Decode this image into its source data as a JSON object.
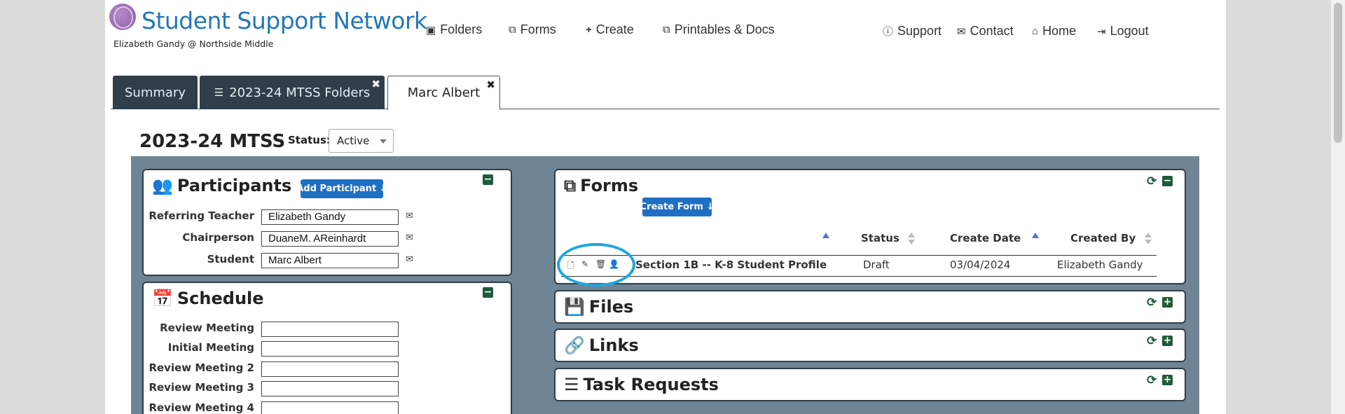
{
  "brand": {
    "title": "Student Support Network",
    "user": "Elizabeth Gandy @ Northside Middle"
  },
  "nav": {
    "folders": "Folders",
    "forms": "Forms",
    "create": "Create",
    "printables": "Printables & Docs",
    "support": "Support",
    "contact": "Contact",
    "home": "Home",
    "logout": "Logout"
  },
  "tabs": [
    {
      "label": "Summary"
    },
    {
      "label": "2023-24 MTSS Folders"
    },
    {
      "label": "Marc Albert"
    }
  ],
  "folder": {
    "title": "2023-24 MTSS",
    "status_label": "Status:",
    "status_value": "Active"
  },
  "participants": {
    "title": "Participants",
    "add_button": "Add Participant ↓",
    "rows": [
      {
        "label": "Referring Teacher",
        "value": "Elizabeth Gandy"
      },
      {
        "label": "Chairperson",
        "value": "DuaneM. AReinhardt"
      },
      {
        "label": "Student",
        "value": "Marc Albert"
      }
    ]
  },
  "schedule": {
    "title": "Schedule",
    "rows": [
      {
        "label": "Review Meeting",
        "value": ""
      },
      {
        "label": "Initial Meeting",
        "value": ""
      },
      {
        "label": "Review Meeting 2",
        "value": ""
      },
      {
        "label": "Review Meeting 3",
        "value": ""
      },
      {
        "label": "Review Meeting 4",
        "value": ""
      }
    ]
  },
  "forms": {
    "title": "Forms",
    "create_button": "Create Form ↓",
    "columns": {
      "status": "Status",
      "create_date": "Create Date",
      "created_by": "Created By"
    },
    "rows": [
      {
        "name": "Section 1B -- K-8 Student Profile",
        "status": "Draft",
        "create_date": "03/04/2024",
        "created_by": "Elizabeth Gandy"
      }
    ]
  },
  "files": {
    "title": "Files"
  },
  "links": {
    "title": "Links"
  },
  "tasks": {
    "title": "Task Requests"
  },
  "colors": {
    "brand_blue": "#2278b8",
    "tab_dark": "#2f3e4a",
    "board": "#6f8494",
    "button_blue": "#1f6fc4",
    "toggle_green": "#1e5b3a",
    "highlight": "#1ea6e0"
  }
}
